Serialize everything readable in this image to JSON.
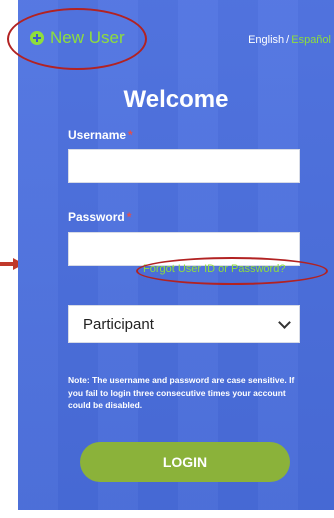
{
  "header": {
    "new_user_label": "New User",
    "lang_english": "English",
    "lang_separator": "/",
    "lang_spanish": "Español"
  },
  "welcome": "Welcome",
  "username": {
    "label": "Username",
    "required_mark": "*",
    "value": ""
  },
  "password": {
    "label": "Password",
    "required_mark": "*",
    "value": ""
  },
  "forgot_link": "Forgot User ID or Password?",
  "role_select": {
    "selected": "Participant",
    "icon": "chevron-down-icon"
  },
  "note": "Note: The username and password are case sensitive. If you fail to login three consecutive times your account could be disabled.",
  "login_button": "LOGIN",
  "colors": {
    "panel": "#4a6fe0",
    "accent_green": "#8ede3c",
    "login_green": "#8bb23a",
    "annotation_red": "#b22222"
  },
  "annotations": [
    "circle-new-user",
    "circle-forgot-link",
    "arrow-password"
  ]
}
